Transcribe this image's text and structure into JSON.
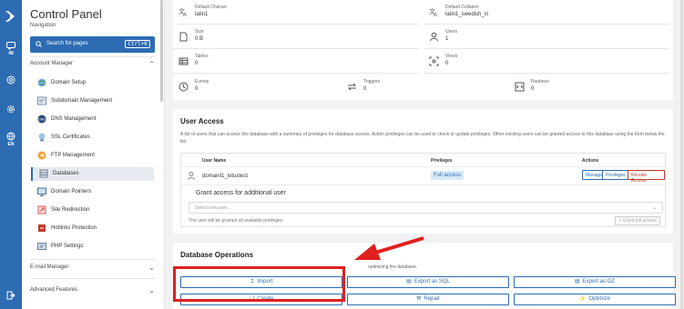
{
  "sidebar": {
    "title": "Control Panel",
    "subtitle": "Navigation",
    "search_placeholder": "Search for pages",
    "search_shortcut": "Ctrl+K",
    "sections": {
      "account_manager": "Account Manager",
      "email_manager": "E-mail Manager",
      "advanced_features": "Advanced Features"
    },
    "items": [
      {
        "label": "Domain Setup",
        "icon": "globe-icon"
      },
      {
        "label": "Subdomain Management",
        "icon": "subdomain-icon"
      },
      {
        "label": "DNS Management",
        "icon": "dns-icon"
      },
      {
        "label": "SSL Certificates",
        "icon": "certificate-icon"
      },
      {
        "label": "FTP Management",
        "icon": "ftp-icon"
      },
      {
        "label": "Databases",
        "icon": "database-icon"
      },
      {
        "label": "Domain Pointers",
        "icon": "monitor-icon"
      },
      {
        "label": "Site Redirection",
        "icon": "redirect-icon"
      },
      {
        "label": "Hotlinks Protection",
        "icon": "hotlink-icon"
      },
      {
        "label": "PHP Settings",
        "icon": "php-icon"
      }
    ]
  },
  "rail": {
    "badge": "48",
    "language": "EN"
  },
  "stats": {
    "charset_label": "Default Charset",
    "charset_value": "latin1",
    "collation_label": "Default Collation",
    "collation_value": "latin1_swedish_ci",
    "size_label": "Size",
    "size_value": "0 B",
    "users_label": "Users",
    "users_value": "1",
    "tables_label": "Tables",
    "tables_value": "0",
    "views_label": "Views",
    "views_value": "0",
    "events_label": "Events",
    "events_value": "0",
    "triggers_label": "Triggers",
    "triggers_value": "0",
    "routines_label": "Routines",
    "routines_value": "0"
  },
  "user_access": {
    "title": "User Access",
    "description": "A list of users that can access this database with a summary of privileges for database access. Action privileges can be used to check or update privileges. Other existing users can be granted access to this database using the form below the list.",
    "columns": {
      "user": "User Name",
      "privileges": "Privileges",
      "actions": "Actions"
    },
    "row": {
      "user": "domainl1_lotustest",
      "privilege": "Full access"
    },
    "actions": {
      "manage": "Manage",
      "privileges": "Privileges",
      "revoke": "Revoke Access"
    },
    "grant_title": "Grant access for additional user",
    "grant_placeholder": "Select new user...",
    "grant_note": "The user will be granted all available privileges",
    "grant_button": "Grant full access"
  },
  "operations": {
    "title": "Database Operations",
    "description": "optimizing the database.",
    "import": "Import",
    "export_sql": "Export as SQL",
    "export_gz": "Export as GZ",
    "create": "Create",
    "repair": "Repair",
    "optimize": "Optimize"
  },
  "colors": {
    "accent": "#2d6cb3",
    "annotation": "#e0201e",
    "revoke": "#c0392b"
  }
}
